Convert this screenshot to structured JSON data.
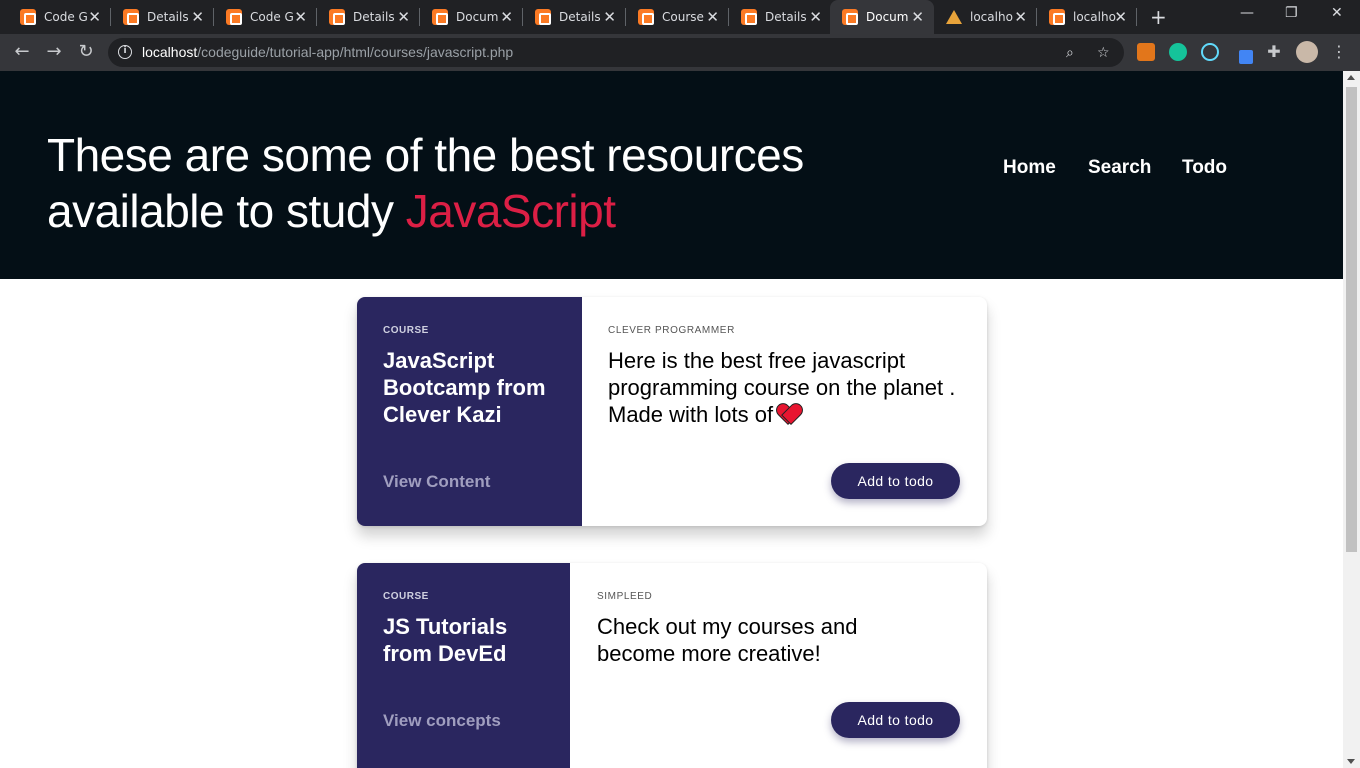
{
  "browser": {
    "tabs": [
      {
        "title": "Code G",
        "icon": "xampp-icon"
      },
      {
        "title": "Details",
        "icon": "xampp-icon"
      },
      {
        "title": "Code G",
        "icon": "xampp-icon"
      },
      {
        "title": "Details",
        "icon": "xampp-icon"
      },
      {
        "title": "Docum",
        "icon": "xampp-icon"
      },
      {
        "title": "Details",
        "icon": "xampp-icon"
      },
      {
        "title": "Course",
        "icon": "xampp-icon"
      },
      {
        "title": "Details",
        "icon": "xampp-icon"
      },
      {
        "title": "Docum",
        "icon": "xampp-icon",
        "active": true
      },
      {
        "title": "localho",
        "icon": "phpmyadmin-icon"
      },
      {
        "title": "localho",
        "icon": "xampp-icon"
      }
    ],
    "url_host": "localhost",
    "url_path": "/codeguide/tutorial-app/html/courses/javascript.php"
  },
  "hero": {
    "heading_line1": "These are some of the best resources",
    "heading_line2": "available to study ",
    "heading_accent": "JavaScript",
    "nav": [
      "Home",
      "Search",
      "Todo"
    ]
  },
  "cards": [
    {
      "label": "COURSE",
      "title": "JavaScript Bootcamp from Clever Kazi",
      "link": "View Content",
      "author": "CLEVER PROGRAMMER",
      "description": "Here is the best free javascript programming course on the planet . Made with lots of",
      "button": "Add to todo"
    },
    {
      "label": "COURSE",
      "title": "JS Tutorials from DevEd",
      "link": "View concepts",
      "author": "SIMPLEED",
      "description": "Check out my courses and become more creative!",
      "button": "Add to todo"
    }
  ],
  "colors": {
    "hero_bg": "#040f16",
    "accent": "#dc1f45",
    "card_side": "#2a265f"
  }
}
